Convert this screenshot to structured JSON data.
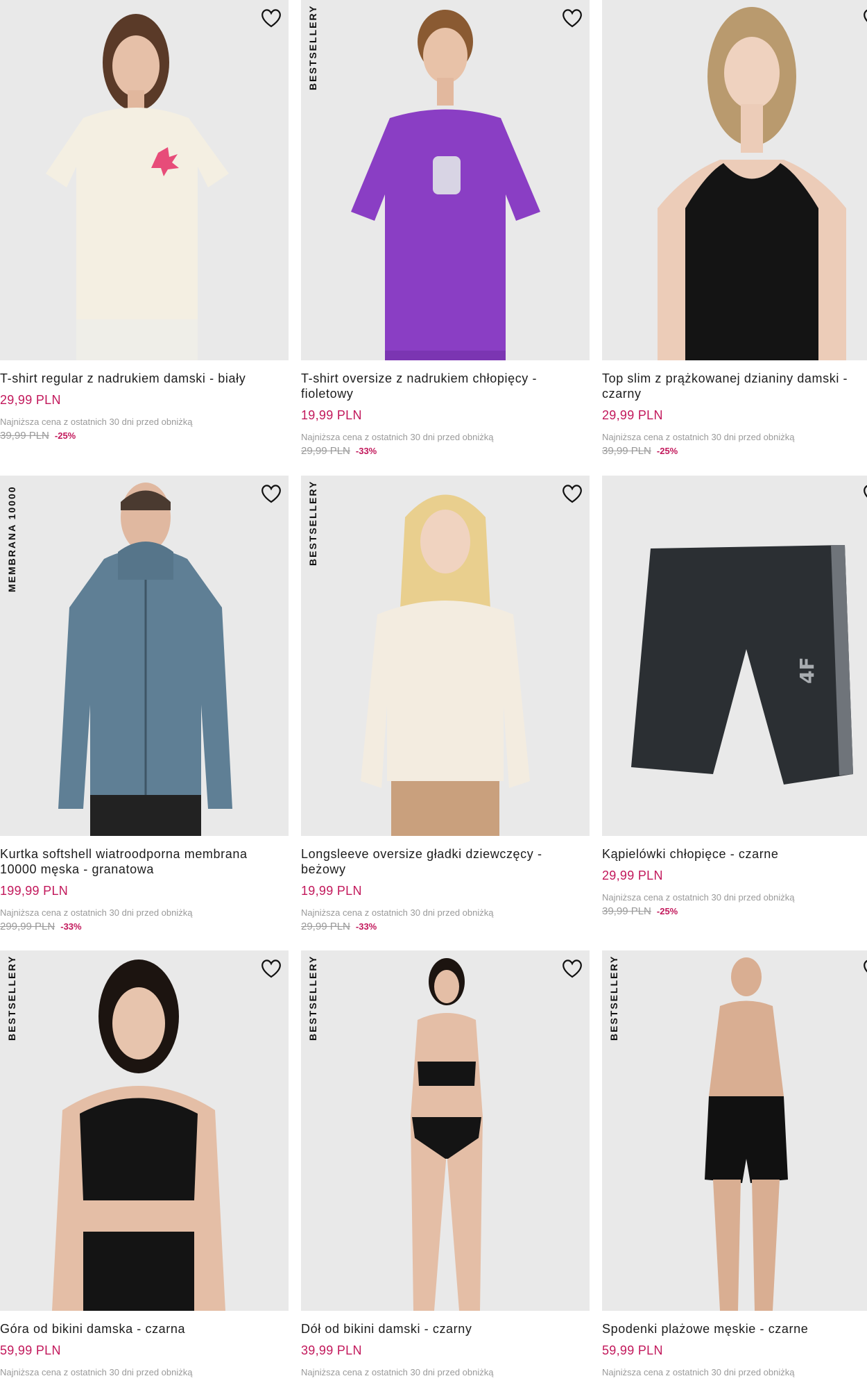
{
  "lowest_label": "Najniższa cena z ostatnich 30 dni przed obniżką",
  "products": [
    {
      "name": "T-shirt regular z nadrukiem damski - biały",
      "price": "29,99 PLN",
      "old_price": "39,99 PLN",
      "discount": "-25%",
      "badge": ""
    },
    {
      "name": "T-shirt oversize z nadrukiem chłopięcy - fioletowy",
      "price": "19,99 PLN",
      "old_price": "29,99 PLN",
      "discount": "-33%",
      "badge": "BESTSELLERY"
    },
    {
      "name": "Top slim z prążkowanej dzianiny damski - czarny",
      "price": "29,99 PLN",
      "old_price": "39,99 PLN",
      "discount": "-25%",
      "badge": ""
    },
    {
      "name": "Kurtka softshell wiatroodporna membrana 10000 męska - granatowa",
      "price": "199,99 PLN",
      "old_price": "299,99 PLN",
      "discount": "-33%",
      "badge": "MEMBRANA 10000"
    },
    {
      "name": "Longsleeve oversize gładki dziewczęcy - beżowy",
      "price": "19,99 PLN",
      "old_price": "29,99 PLN",
      "discount": "-33%",
      "badge": "BESTSELLERY"
    },
    {
      "name": "Kąpielówki chłopięce - czarne",
      "price": "29,99 PLN",
      "old_price": "39,99 PLN",
      "discount": "-25%",
      "badge": ""
    },
    {
      "name": "Góra od bikini damska - czarna",
      "price": "59,99 PLN",
      "old_price": "",
      "discount": "",
      "badge": "BESTSELLERY"
    },
    {
      "name": "Dół od bikini damski - czarny",
      "price": "39,99 PLN",
      "old_price": "",
      "discount": "",
      "badge": "BESTSELLERY"
    },
    {
      "name": "Spodenki plażowe męskie - czarne",
      "price": "59,99 PLN",
      "old_price": "",
      "discount": "",
      "badge": "BESTSELLERY"
    }
  ],
  "icons": {
    "wishlist": "heart-outline-icon"
  },
  "colors": {
    "price": "#c2185b",
    "muted": "#9a9a9a",
    "photo_bg": "#e9e9e9"
  }
}
